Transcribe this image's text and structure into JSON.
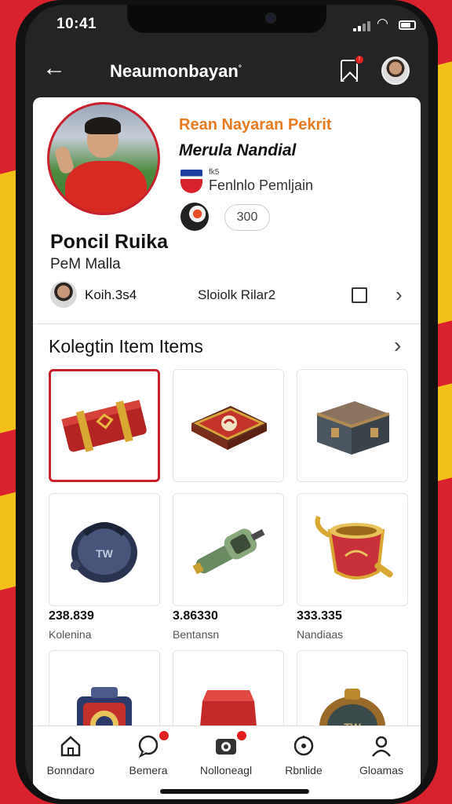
{
  "status": {
    "time": "10:41"
  },
  "nav": {
    "title": "Neaumonbayan",
    "title_mark": "°"
  },
  "profile": {
    "headline": "Rean Nayaran Pekrit",
    "team": "Merula Nandial",
    "flag_small": "fk5",
    "club": "Fenlnlo Pemljain",
    "count": "300",
    "name": "Poncil Ruika",
    "subtitle": "PeM Malla"
  },
  "stats": {
    "left": "Koih.3s4",
    "middle": "Sloiolk Rilar2"
  },
  "section": {
    "title": "Kolegtin Item Items"
  },
  "items": [
    {
      "icon": "red-gold-case-icon",
      "value": "",
      "label": ""
    },
    {
      "icon": "dragon-chest-icon",
      "value": "",
      "label": ""
    },
    {
      "icon": "steel-trunk-icon",
      "value": "",
      "label": ""
    },
    {
      "icon": "round-badge-icon",
      "value": "238.839",
      "label": "Kolenina"
    },
    {
      "icon": "green-blaster-icon",
      "value": "3.86330",
      "label": "Bentansn"
    },
    {
      "icon": "golden-cup-icon",
      "value": "333.335",
      "label": "Nandiaas"
    },
    {
      "icon": "blue-lantern-icon",
      "value": "",
      "label": ""
    },
    {
      "icon": "red-pouch-icon",
      "value": "",
      "label": ""
    },
    {
      "icon": "bronze-compass-icon",
      "value": "",
      "label": ""
    }
  ],
  "tabs": [
    {
      "label": "Bonndaro",
      "icon": "home-icon",
      "dot": false
    },
    {
      "label": "Bemera",
      "icon": "chat-icon",
      "dot": true
    },
    {
      "label": "Nolloneagl",
      "icon": "camera-icon",
      "dot": true
    },
    {
      "label": "Rbnlide",
      "icon": "bell-icon",
      "dot": false
    },
    {
      "label": "Gloamas",
      "icon": "user-icon",
      "dot": false
    }
  ],
  "colors": {
    "accent": "#c8202c",
    "background_red": "#d8232f",
    "background_yellow": "#f2c019"
  }
}
